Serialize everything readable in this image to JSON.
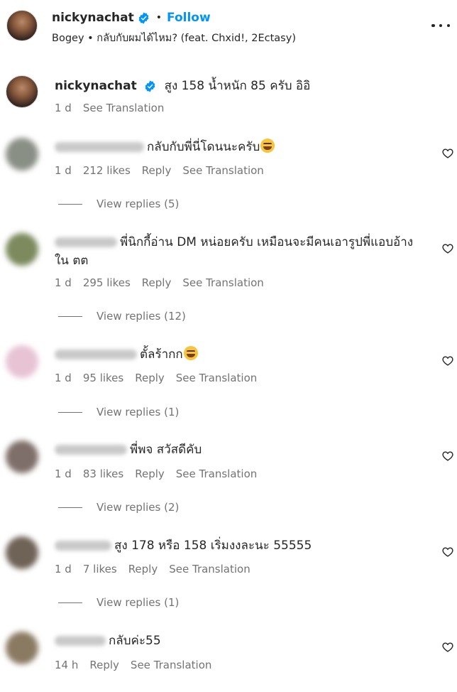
{
  "header": {
    "username": "nickynachat",
    "dot": "•",
    "follow_label": "Follow",
    "audio": "Bogey • กลับกับผมได้ไหม? (feat. Chxid!, 2Ectasy)"
  },
  "owner_comment": {
    "username": "nickynachat",
    "text": "สูง 158 น้ำหนัก 85 ครับ อิอิ",
    "time": "1 d",
    "translate_label": "See Translation"
  },
  "comments": [
    {
      "text": "กลับกับพี่นี่โดนนะครับ",
      "emoji": true,
      "time": "1 d",
      "likes": "212 likes",
      "reply_label": "Reply",
      "translate_label": "See Translation",
      "view_replies": "View replies (5)",
      "avatar_color": "#8a8f86"
    },
    {
      "text": "พี่นิกกี้อ่าน DM หน่อยครับ เหมือนจะมีคนเอารูปพี่แอบอ้าง",
      "text2": "ใน ตต",
      "emoji": false,
      "time": "1 d",
      "likes": "295 likes",
      "reply_label": "Reply",
      "translate_label": "See Translation",
      "view_replies": "View replies (12)",
      "avatar_color": "#7c8a5e"
    },
    {
      "text": "ตั้ลร้ากก",
      "emoji": true,
      "time": "1 d",
      "likes": "95 likes",
      "reply_label": "Reply",
      "translate_label": "See Translation",
      "view_replies": "View replies (1)",
      "avatar_color": "#e7c3d4"
    },
    {
      "text": "พี่พจ สวัสดีคับ",
      "emoji": false,
      "time": "1 d",
      "likes": "83 likes",
      "reply_label": "Reply",
      "translate_label": "See Translation",
      "view_replies": "View replies (2)",
      "avatar_color": "#7f6f6a"
    },
    {
      "text": "สูง 178 หรือ 158 เริ่มงงละนะ 55555",
      "emoji": false,
      "time": "1 d",
      "likes": "7 likes",
      "reply_label": "Reply",
      "translate_label": "See Translation",
      "view_replies": "View replies (1)",
      "avatar_color": "#6f6257"
    },
    {
      "text": "กลับค่ะ55",
      "emoji": false,
      "time": "14 h",
      "likes": "",
      "reply_label": "Reply",
      "translate_label": "See Translation",
      "view_replies": "",
      "avatar_color": "#8b7a62"
    }
  ],
  "colors": {
    "accent": "#0095f6",
    "verified": "#0095f6",
    "meta_text": "#737373",
    "primary_text": "#262626"
  }
}
